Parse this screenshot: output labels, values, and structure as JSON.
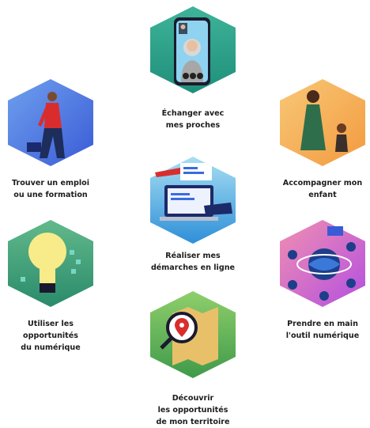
{
  "tiles": [
    {
      "id": "echanger",
      "lines": [
        "Échanger avec",
        "mes proches"
      ],
      "icon": "video-call-icon",
      "colors": {
        "top": "#3fb39a",
        "bottom": "#1f8f7a"
      }
    },
    {
      "id": "emploi",
      "lines": [
        "Trouver un emploi",
        "ou une formation"
      ],
      "icon": "job-seeker-icon",
      "colors": {
        "top": "#6fa0ee",
        "bottom": "#3a5bd6"
      }
    },
    {
      "id": "enfant",
      "lines": [
        "Accompagner mon",
        "enfant"
      ],
      "icon": "parent-child-icon",
      "colors": {
        "top": "#f8c877",
        "bottom": "#f39a3f"
      }
    },
    {
      "id": "demarches",
      "lines": [
        "Réaliser mes",
        "démarches en ligne"
      ],
      "icon": "online-form-icon",
      "colors": {
        "top": "#a8dff3",
        "bottom": "#2e8fd8"
      }
    },
    {
      "id": "opportunites",
      "lines": [
        "Utiliser les",
        "opportunités",
        "du numérique"
      ],
      "icon": "lightbulb-icon",
      "colors": {
        "top": "#62b98b",
        "bottom": "#2a8b6b"
      }
    },
    {
      "id": "outil",
      "lines": [
        "Prendre en main",
        "l'outil numérique"
      ],
      "icon": "globe-apps-icon",
      "colors": {
        "top": "#f08fb2",
        "bottom": "#b44fe0"
      }
    },
    {
      "id": "territoire",
      "lines": [
        "Découvrir",
        "les opportunités",
        "de mon territoire"
      ],
      "icon": "map-search-icon",
      "colors": {
        "top": "#8fcf6b",
        "bottom": "#3f9a4a"
      }
    }
  ]
}
